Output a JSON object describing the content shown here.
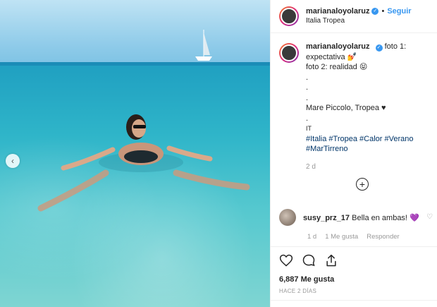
{
  "post": {
    "username": "marianaloyolaruz",
    "verified_icon": "verified-badge-icon",
    "follow_label": "Seguir",
    "separator": "•",
    "location": "Italia Tropea"
  },
  "caption": {
    "line1": "foto 1: expectativa 💅",
    "line2": "foto 2: realidad 😝",
    "dots": [
      ".",
      ".",
      "."
    ],
    "place": "Mare Piccolo, Tropea ♥",
    "dot4": ".",
    "lang": "IT",
    "tags_line1": "#Italia #Tropea #Calor #Verano",
    "tags_line2": "#MarTirreno",
    "time": "2 d"
  },
  "more_comments": "+",
  "comment": {
    "username": "susy_prz_17",
    "text": "Bella en ambas!",
    "emoji": "💜",
    "time": "1 d",
    "likes": "1 Me gusta",
    "reply": "Responder"
  },
  "actions": {
    "likes": "6,887 Me gusta",
    "ago": "HACE 2 DÍAS"
  },
  "colors": {
    "accent": "#3897f0",
    "hashtag": "#003569",
    "meta": "#999999"
  }
}
